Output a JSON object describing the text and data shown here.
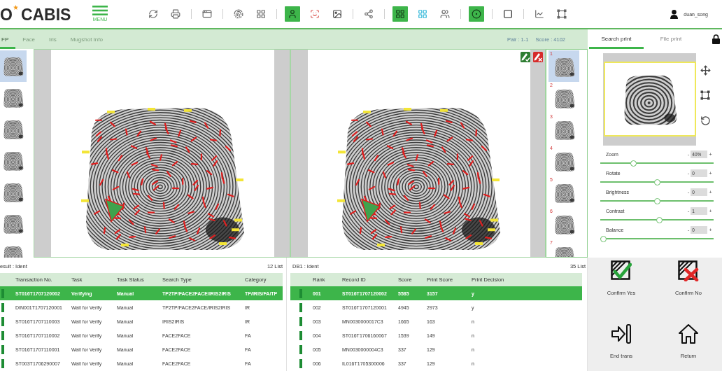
{
  "header": {
    "logo_mark": "O",
    "logo_text": "CABIS",
    "menu_label": "MENU",
    "user": "duan_song"
  },
  "toolbar": [
    [
      {
        "on": false
      },
      {
        "on": false
      }
    ],
    [
      {
        "on": false
      }
    ],
    [
      {
        "on": false
      },
      {
        "on": false
      }
    ],
    [
      {
        "on": true
      },
      {
        "on": false
      },
      {
        "on": false
      }
    ],
    [
      {
        "on": false
      }
    ],
    [
      {
        "on": true
      },
      {
        "on": false
      },
      {
        "on": false
      }
    ],
    [
      {
        "on": true
      }
    ],
    [
      {
        "on": false
      }
    ],
    [
      {
        "on": false
      },
      {
        "on": false
      }
    ]
  ],
  "tabs": [
    {
      "label": "FP",
      "selected": true
    },
    {
      "label": "Face",
      "selected": false
    },
    {
      "label": "Iris",
      "selected": false
    },
    {
      "label": "Mugshot Info",
      "selected": false
    }
  ],
  "match_info": {
    "pair": "Pair : 1-1",
    "score": "Score : 4102"
  },
  "print_tabs": [
    {
      "label": "Search print",
      "selected": true
    },
    {
      "label": "File print",
      "selected": false
    }
  ],
  "left_thumbnails": [
    {
      "selected": true
    },
    {
      "selected": false
    },
    {
      "selected": false
    },
    {
      "selected": false
    },
    {
      "selected": false
    },
    {
      "selected": false
    },
    {
      "selected": false
    }
  ],
  "right_thumbnails": [
    {
      "number": "1",
      "selected": true
    },
    {
      "number": "2",
      "selected": false
    },
    {
      "number": "3",
      "selected": false
    },
    {
      "number": "4",
      "selected": false
    },
    {
      "number": "5",
      "selected": false
    },
    {
      "number": "6",
      "selected": false
    },
    {
      "number": "7",
      "selected": false
    }
  ],
  "adjustments": [
    {
      "label": "Zoom",
      "decrease": "-",
      "value": "40%",
      "increase": "+",
      "level": 0.28
    },
    {
      "label": "Rotate",
      "decrease": "-",
      "value": "0",
      "increase": "+",
      "level": 0.5
    },
    {
      "label": "Brightness",
      "decrease": "-",
      "value": "0",
      "increase": "+",
      "level": 0.5
    },
    {
      "label": "Contrast",
      "decrease": "-",
      "value": "1",
      "increase": "+",
      "level": 0.52
    },
    {
      "label": "Balance",
      "decrease": "-",
      "value": "0",
      "increase": "+",
      "level": 0
    }
  ],
  "result_tables": [
    {
      "title": "esult : Ident",
      "count": "12 List",
      "columns": [
        "Transaction No.",
        "Task",
        "Task Status",
        "Search Type",
        "Category"
      ],
      "rows": [
        {
          "selected": true,
          "cells": [
            "ST016T1707120002",
            "Verifying",
            "Manual",
            "TP2TP/FACE2FACE/IRIS2IRIS",
            "TP/IRIS/FA/TP"
          ]
        },
        {
          "selected": false,
          "cells": [
            "DIN001T1707120001",
            "Wait for Verify",
            "Manual",
            "TP2TP/FACE2FACE/IRIS2IRIS",
            "IR"
          ]
        },
        {
          "selected": false,
          "cells": [
            "ST016T1707110003",
            "Wait for Verify",
            "Manual",
            "IRIS2IRIS",
            "IR"
          ]
        },
        {
          "selected": false,
          "cells": [
            "ST016T1707110002",
            "Wait for Verify",
            "Manual",
            "FACE2FACE",
            "FA"
          ]
        },
        {
          "selected": false,
          "cells": [
            "ST016T1707110001",
            "Wait for Verify",
            "Manual",
            "FACE2FACE",
            "FA"
          ]
        },
        {
          "selected": false,
          "cells": [
            "ST003T1706290007",
            "Wait for Verify",
            "Manual",
            "FACE2FACE",
            "FA"
          ]
        }
      ]
    },
    {
      "title": "DB1 : Ident",
      "count": "35 List",
      "columns": [
        "Rank",
        "Record ID",
        "Score",
        "Print Score",
        "Print Decision"
      ],
      "rows": [
        {
          "selected": true,
          "cells": [
            "001",
            "ST016T1707120002",
            "5585",
            "3157",
            "y"
          ]
        },
        {
          "selected": false,
          "cells": [
            "002",
            "ST016T1707120001",
            "4945",
            "2973",
            "y"
          ]
        },
        {
          "selected": false,
          "cells": [
            "003",
            "MN0030000017C3",
            "1665",
            "163",
            "n"
          ]
        },
        {
          "selected": false,
          "cells": [
            "004",
            "ST016T1706160067",
            "1539",
            "149",
            "n"
          ]
        },
        {
          "selected": false,
          "cells": [
            "005",
            "MN0030000004C3",
            "337",
            "129",
            "n"
          ]
        },
        {
          "selected": false,
          "cells": [
            "006",
            "IL016T1705300006",
            "337",
            "129",
            "n"
          ]
        }
      ]
    }
  ],
  "actions": [
    {
      "kind": "confirm_yes",
      "label": "Confirm Yes"
    },
    {
      "kind": "confirm_no",
      "label": "Confirm No"
    },
    {
      "kind": "end",
      "label": "End trans"
    },
    {
      "kind": "home",
      "label": "Return"
    }
  ]
}
